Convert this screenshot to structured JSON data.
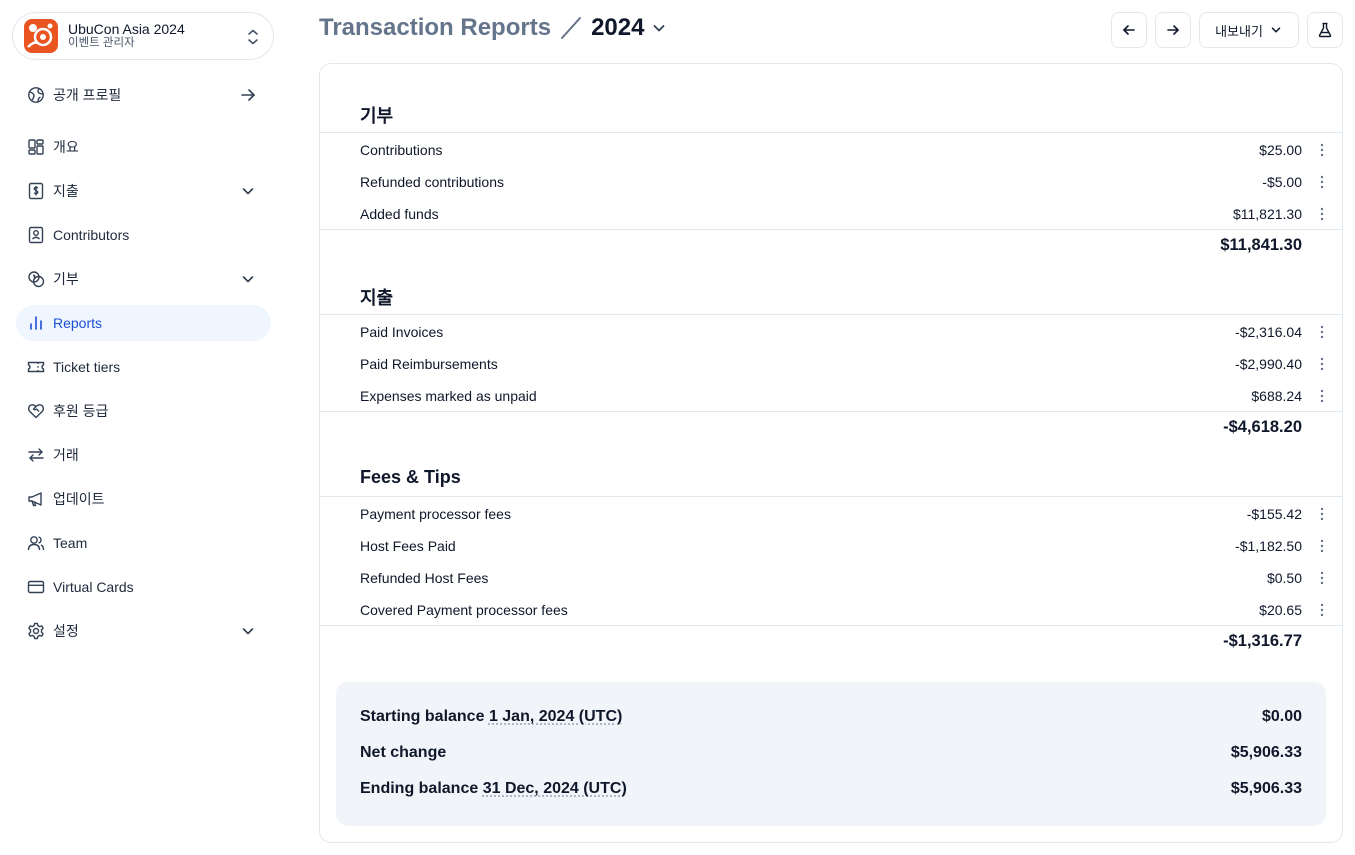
{
  "account": {
    "name": "UbuCon Asia 2024",
    "role": "이벤트 관리자"
  },
  "sidebar": {
    "public_profile": "공개 프로필",
    "items": [
      {
        "label": "개요",
        "icon": "overview-grid-icon"
      },
      {
        "label": "지출",
        "icon": "receipt-dollar-icon",
        "expandable": true
      },
      {
        "label": "Contributors",
        "icon": "contact-badge-icon"
      },
      {
        "label": "기부",
        "icon": "coins-icon",
        "expandable": true
      },
      {
        "label": "Reports",
        "icon": "bar-chart-icon",
        "active": true
      },
      {
        "label": "Ticket tiers",
        "icon": "ticket-icon"
      },
      {
        "label": "후원 등급",
        "icon": "heart-handshake-icon"
      },
      {
        "label": "거래",
        "icon": "arrows-exchange-icon"
      },
      {
        "label": "업데이트",
        "icon": "megaphone-icon"
      },
      {
        "label": "Team",
        "icon": "users-icon"
      },
      {
        "label": "Virtual Cards",
        "icon": "credit-card-icon"
      },
      {
        "label": "설정",
        "icon": "gear-icon",
        "expandable": true
      }
    ]
  },
  "header": {
    "title": "Transaction Reports",
    "period": "2024",
    "export_label": "내보내기"
  },
  "report": {
    "contributions": {
      "title": "기부",
      "rows": [
        {
          "label": "Contributions",
          "value": "$25.00"
        },
        {
          "label": "Refunded contributions",
          "value": "-$5.00"
        },
        {
          "label": "Added funds",
          "value": "$11,821.30"
        }
      ],
      "total": "$11,841.30"
    },
    "expenses": {
      "title": "지출",
      "rows": [
        {
          "label": "Paid Invoices",
          "value": "-$2,316.04"
        },
        {
          "label": "Paid Reimbursements",
          "value": "-$2,990.40"
        },
        {
          "label": "Expenses marked as unpaid",
          "value": "$688.24"
        }
      ],
      "total": "-$4,618.20"
    },
    "fees": {
      "title": "Fees & Tips",
      "rows": [
        {
          "label": "Payment processor fees",
          "value": "-$155.42"
        },
        {
          "label": "Host Fees Paid",
          "value": "-$1,182.50"
        },
        {
          "label": "Refunded Host Fees",
          "value": "$0.50"
        },
        {
          "label": "Covered Payment processor fees",
          "value": "$20.65"
        }
      ],
      "total": "-$1,316.77"
    },
    "summary": {
      "starting_label": "Starting balance",
      "starting_date": "1 Jan, 2024 (UTC)",
      "starting_value": "$0.00",
      "net_label": "Net change",
      "net_value": "$5,906.33",
      "ending_label": "Ending balance",
      "ending_date": "31 Dec, 2024 (UTC)",
      "ending_value": "$5,906.33"
    }
  },
  "colors": {
    "accent": "#1d4ed8",
    "active_bg": "#eff6ff",
    "brand": "#e95420",
    "summary_bg": "#f1f5f9"
  }
}
